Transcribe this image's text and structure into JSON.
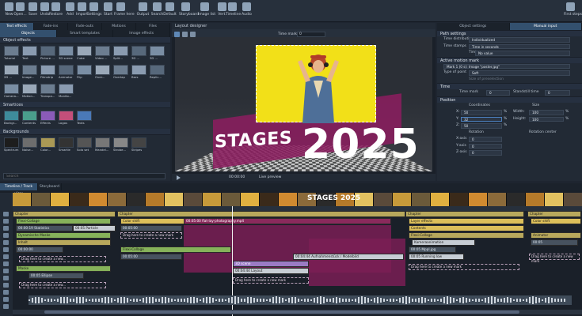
{
  "toolbar": {
    "buttons": [
      "New",
      "Open...",
      "Save",
      "Undo",
      "Restore",
      "Add",
      "Import",
      "Settings",
      "Start",
      "Frame here",
      "Output",
      "Search",
      "Default",
      "Storyboard",
      "Image list",
      "Vert.",
      "Timeline",
      "Audio"
    ],
    "first_steps": "First steps"
  },
  "left": {
    "tabs_top": [
      "Text effects",
      "Fade-ins",
      "Fade-outs",
      "Motions",
      "Files"
    ],
    "tabs_sub": [
      "Objects",
      "Smart templates",
      "Image effects"
    ],
    "object_effects_header": "Object effects",
    "objects": [
      {
        "label": "Tutorial"
      },
      {
        "label": "Text"
      },
      {
        "label": "Picture ..."
      },
      {
        "label": "3D scene"
      },
      {
        "label": "Cube"
      },
      {
        "label": "Video ..."
      },
      {
        "label": "Split..."
      },
      {
        "label": "3D ..."
      },
      {
        "label": "3D ..."
      },
      {
        "label": "2D ..."
      },
      {
        "label": "Image..."
      },
      {
        "label": "Filmstrip"
      },
      {
        "label": "Animator"
      },
      {
        "label": "Flip"
      },
      {
        "label": "Over..."
      },
      {
        "label": "Overlap"
      },
      {
        "label": "Bars"
      },
      {
        "label": "Replic..."
      },
      {
        "label": "Camera..."
      },
      {
        "label": "Motion..."
      },
      {
        "label": "Transpa..."
      },
      {
        "label": "Monito..."
      }
    ],
    "smartices_header": "Smartices",
    "smartices": [
      {
        "label": "Backgr..."
      },
      {
        "label": "Contents"
      },
      {
        "label": "Effects"
      },
      {
        "label": "Logos"
      },
      {
        "label": "Texts"
      }
    ],
    "backgrounds_header": "Backgrounds",
    "backgrounds": [
      {
        "label": "Spectrum"
      },
      {
        "label": "Noise..."
      },
      {
        "label": "Color..."
      },
      {
        "label": "Smartle"
      },
      {
        "label": "Sola set"
      },
      {
        "label": "Mandel..."
      },
      {
        "label": "Strobe..."
      },
      {
        "label": "Stripes"
      }
    ],
    "search_placeholder": "Search"
  },
  "preview": {
    "title": "Layout designer",
    "zoom_label": "Time mark",
    "zoom_value": "0",
    "stage_text": "STAGES",
    "year_text": "2025",
    "time_code": "00:00:00",
    "live_preview": "Live preview"
  },
  "right": {
    "tabs": [
      "Object settings",
      "Manual input"
    ],
    "path_settings_header": "Path settings",
    "time_distribution_label": "Time distribution",
    "time_distribution_value": "Individualized",
    "time_stamps_label": "Time stamps",
    "time_stamps_value": "Time in seconds",
    "timing_label": "Timing",
    "timing_value": "No value",
    "active_motion_header": "Active motion mark",
    "active_mark_value": "Mark 1 (0 s): Image \"poster.jpg\"",
    "type_label": "Type of point",
    "type_value": "Soft",
    "size_of_ui_label": "Size of preselection",
    "time_header": "Time",
    "time_mark_label": "Time mark",
    "time_mark_value": "0",
    "standstill_label": "Standstill time",
    "standstill_value": "0",
    "position_header": "Position",
    "coordinates_label": "Coordinates",
    "size_label": "Size",
    "x_label": "X:",
    "x_value": "50",
    "y_label": "Y:",
    "y_value": "32",
    "z_label": "Z:",
    "z_value": "50",
    "width_label": "Width:",
    "width_value": "100",
    "height_label": "Height:",
    "height_value": "100",
    "rotation_label": "Rotation",
    "rotation_center_label": "Rotation center",
    "xaxis_label": "X-axis",
    "xaxis_value": "0",
    "yaxis_label": "Y-axis",
    "yaxis_value": "0",
    "zaxis_label": "Z-axis",
    "zaxis_value": "0",
    "percent": "%"
  },
  "timeline": {
    "tabs": [
      "Timeline / Track view",
      "Storyboard"
    ],
    "filmstrip_text": "STAGES 2025",
    "clips": [
      {
        "label": "Chapter"
      },
      {
        "label": "Flexi-Collage"
      },
      {
        "label": "00:00:19 Statistics"
      },
      {
        "label": "00:05 Particle"
      },
      {
        "label": "Dynamische Maske"
      },
      {
        "label": "Inhalt"
      },
      {
        "label": "00:00:00"
      },
      {
        "label": "Drag here to create a new..."
      },
      {
        "label": "Maske"
      },
      {
        "label": "00:05 Ellipse"
      },
      {
        "label": "Drag here to create a new..."
      },
      {
        "label": "Chapter"
      },
      {
        "label": "Color shift"
      },
      {
        "label": "00:05:00"
      },
      {
        "label": "00:05:00 flat-lay-photography.mp4"
      },
      {
        "label": "Drag here to create a new mark"
      },
      {
        "label": "Flexi-Collage"
      },
      {
        "label": "00:05:00"
      },
      {
        "label": "00:04:44 Aufnahmenstück / Modelbild"
      },
      {
        "label": "3D scene"
      },
      {
        "label": "00:04:44 Layout"
      },
      {
        "label": "Drag here to create a new mark"
      },
      {
        "label": "Chapter"
      },
      {
        "label": "Layer effects"
      },
      {
        "label": "Contents"
      },
      {
        "label": "Flexi-Collage"
      },
      {
        "label": "Kameraanimation"
      },
      {
        "label": "00:05 Mppl.jpg"
      },
      {
        "label": "00:05 Running low"
      },
      {
        "label": "Drag here to create a new mark"
      },
      {
        "label": "Chapter"
      },
      {
        "label": "Color shift"
      },
      {
        "label": "Animator"
      },
      {
        "label": "00:05"
      },
      {
        "label": "Drag here to create a new mark"
      }
    ]
  }
}
